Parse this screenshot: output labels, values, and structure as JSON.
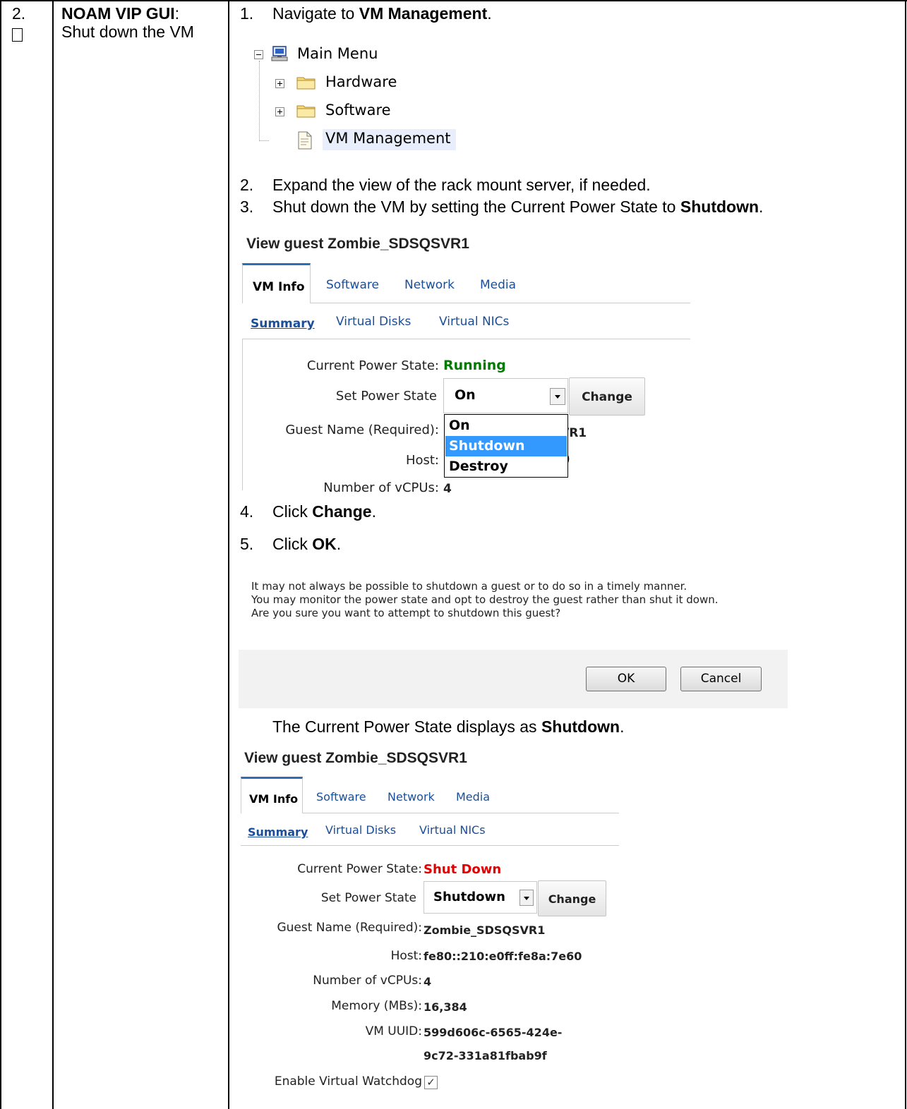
{
  "step": {
    "number": "2.",
    "title_bold": "NOAM VIP GUI",
    "title_colon": ":",
    "subtitle": "Shut down the VM"
  },
  "instructions": {
    "s1_num": "1.",
    "s1_pre": "Navigate to ",
    "s1_bold": "VM Management",
    "s1_post": ".",
    "s2_num": "2.",
    "s2_text": "Expand the view of the rack mount server, if needed.",
    "s3_num": "3.",
    "s3_pre": "Shut down the VM by setting the Current Power State to ",
    "s3_bold": "Shutdown",
    "s3_post": ".",
    "s4_num": "4.",
    "s4_pre": "Click ",
    "s4_bold": "Change",
    "s4_post": ".",
    "s5_num": "5.",
    "s5_pre": "Click ",
    "s5_bold": "OK",
    "s5_post": ".",
    "result_pre": "The Current Power State displays as ",
    "result_bold": "Shutdown",
    "result_post": "."
  },
  "tree": {
    "root": "Main Menu",
    "items": [
      "Hardware",
      "Software",
      "VM Management"
    ]
  },
  "guest1": {
    "title": "View guest Zombie_SDSQSVR1",
    "tabs": [
      "VM Info",
      "Software",
      "Network",
      "Media"
    ],
    "subtabs": [
      "Summary",
      "Virtual Disks",
      "Virtual NICs"
    ],
    "current_power_label": "Current Power State:",
    "current_power_value": "Running",
    "set_power_label": "Set Power State",
    "set_power_value": "On",
    "change_button": "Change",
    "guest_name_label": "Guest Name (Required):",
    "guest_name_partial": "/R1",
    "host_label": "Host:",
    "host_partial": ")",
    "vcpus_label": "Number of vCPUs:",
    "vcpus_value": "4",
    "dropdown_options": [
      "On",
      "Shutdown",
      "Destroy"
    ]
  },
  "dialog": {
    "line1": "It may not always be possible to shutdown a guest or to do so in a timely manner.",
    "line2": "You may monitor the power state and opt to destroy the guest rather than shut it down.",
    "line3": "Are you sure you want to attempt to shutdown this guest?",
    "ok": "OK",
    "cancel": "Cancel"
  },
  "guest2": {
    "title": "View guest Zombie_SDSQSVR1",
    "tabs": [
      "VM Info",
      "Software",
      "Network",
      "Media"
    ],
    "subtabs": [
      "Summary",
      "Virtual Disks",
      "Virtual NICs"
    ],
    "current_power_label": "Current Power State:",
    "current_power_value": "Shut Down",
    "set_power_label": "Set Power State",
    "set_power_value": "Shutdown",
    "change_button": "Change",
    "guest_name_label": "Guest Name (Required):",
    "guest_name_value": "Zombie_SDSQSVR1",
    "host_label": "Host:",
    "host_value": "fe80::210:e0ff:fe8a:7e60",
    "vcpus_label": "Number of vCPUs:",
    "vcpus_value": "4",
    "memory_label": "Memory (MBs):",
    "memory_value": "16,384",
    "uuid_label": "VM UUID:",
    "uuid_line1": "599d606c-6565-424e-",
    "uuid_line2": "9c72-331a81fbab9f",
    "watchdog_label": "Enable Virtual Watchdog",
    "watchdog_mark": "✓"
  },
  "colors": {
    "running": "#007a00",
    "shutdown": "#e00000",
    "link": "#1a4e99",
    "selection": "#3399ff"
  }
}
